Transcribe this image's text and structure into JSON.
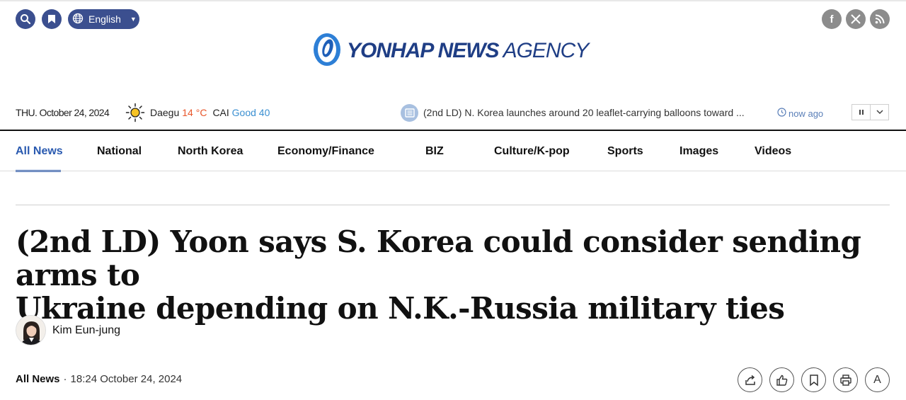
{
  "header": {
    "search_icon": "search-icon",
    "bookmark_icon": "bookmark-icon",
    "language": "English",
    "social": [
      {
        "name": "facebook-icon",
        "glyph": "f"
      },
      {
        "name": "x-icon",
        "glyph": "X"
      },
      {
        "name": "rss-icon",
        "glyph": "rss"
      }
    ]
  },
  "logo": {
    "main": "YONHAP NEWS",
    "sub": "AGENCY",
    "color": "#1f3e85"
  },
  "info": {
    "date": "THU. October 24, 2024",
    "weather_icon": "sun-icon",
    "city": "Daegu",
    "temp": "14 °C",
    "cai_label": "CAI",
    "cai_value": "Good 40"
  },
  "ticker": {
    "headline": "(2nd LD) N. Korea launches around 20 leaflet-carrying balloons toward ...",
    "time": "now ago",
    "pause_icon": "pause-icon",
    "expand_icon": "chevron-down-icon"
  },
  "nav": {
    "items": [
      "All News",
      "National",
      "North Korea",
      "Economy/Finance",
      "BIZ",
      "Culture/K-pop",
      "Sports",
      "Images",
      "Videos"
    ],
    "active": "All News",
    "accent": "#2a5ab0"
  },
  "article": {
    "headline_line1": "(2nd LD) Yoon says S. Korea could consider sending arms to",
    "headline_line2": "Ukraine depending on N.K.-Russia military ties",
    "author": "Kim Eun-jung",
    "category": "All News",
    "datetime": "18:24 October 24, 2024",
    "tools": [
      "share-icon",
      "like-icon",
      "bookmark-icon",
      "print-icon",
      "font-size-icon"
    ],
    "font_tool_label": "A"
  }
}
